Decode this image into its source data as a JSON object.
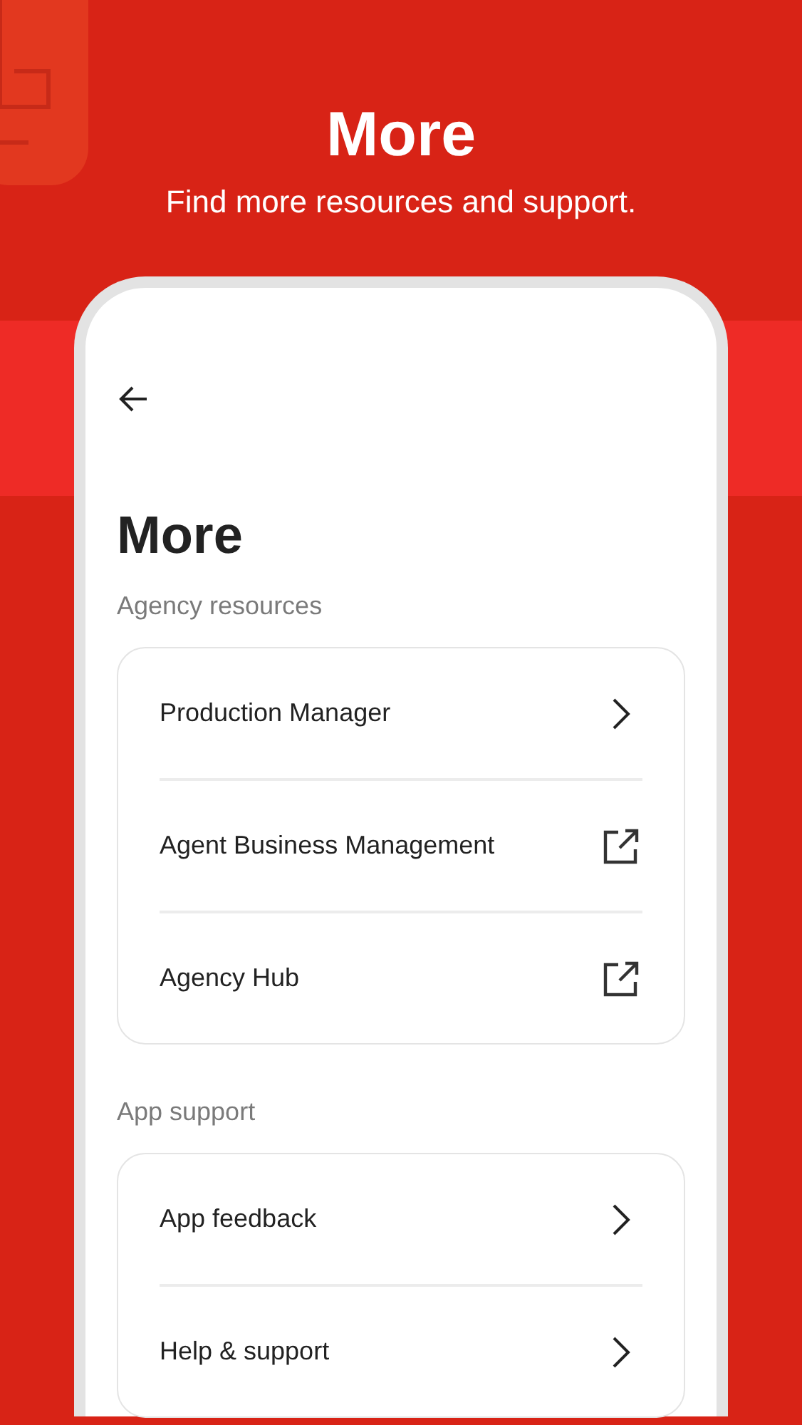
{
  "banner": {
    "title": "More",
    "subtitle": "Find more resources and support."
  },
  "screen": {
    "title": "More",
    "sections": [
      {
        "heading": "Agency resources",
        "items": [
          {
            "label": "Production Manager",
            "kind": "link"
          },
          {
            "label": "Agent Business Management",
            "kind": "external"
          },
          {
            "label": "Agency Hub",
            "kind": "external"
          }
        ]
      },
      {
        "heading": "App support",
        "items": [
          {
            "label": "App feedback",
            "kind": "link"
          },
          {
            "label": "Help & support",
            "kind": "link"
          }
        ]
      }
    ]
  }
}
